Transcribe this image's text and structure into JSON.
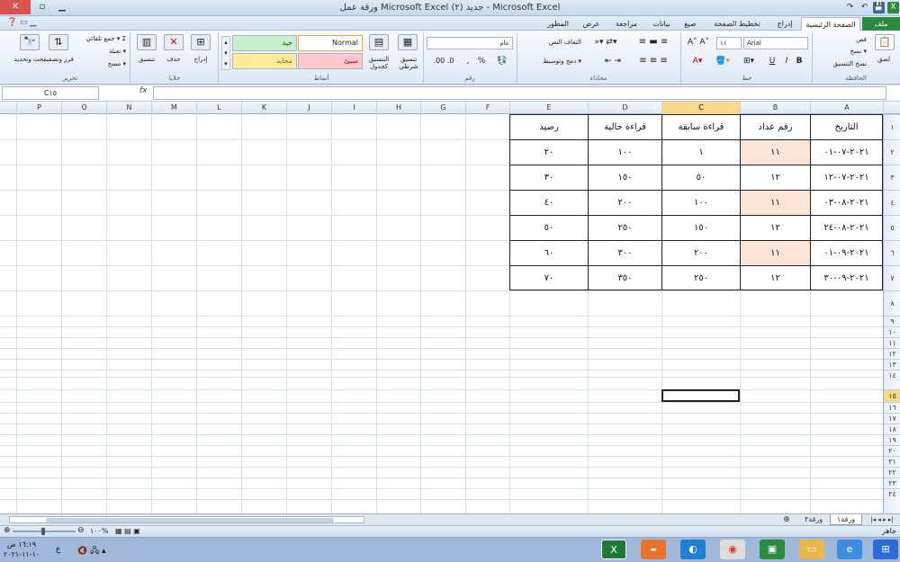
{
  "window": {
    "title": "ورقة عمل Microsoft Excel جديد (٢) - Microsoft Excel"
  },
  "qat": {
    "save": "💾",
    "undo": "↶",
    "redo": "↷"
  },
  "tabs": [
    "ملف",
    "الصفحة الرئيسية",
    "إدراج",
    "تخطيط الصفحة",
    "صيغ",
    "بيانات",
    "مراجعة",
    "عرض",
    "المطور"
  ],
  "ribbon": {
    "clipboard": {
      "label": "الحافظة",
      "paste": "لصق",
      "cut": "قص",
      "copy": "نسخ ▾",
      "format_painter": "نسخ التنسيق"
    },
    "font": {
      "label": "خط",
      "name": "Arial",
      "size": "١١",
      "bold": "B",
      "italic": "I",
      "underline": "U"
    },
    "alignment": {
      "label": "محاذاة",
      "wrap": "التفاف النص",
      "merge": "دمج وتوسيط ▾"
    },
    "number": {
      "label": "رقم",
      "format": "عام",
      "percent": "%",
      "comma": ",",
      "currency": "💱"
    },
    "styles": {
      "label": "أنماط",
      "normal": "Normal",
      "good": "جيد",
      "bad": "سيئ",
      "neutral": "محايد",
      "conditional": "تنسيق شرطي",
      "table": "التنسيق كجدول"
    },
    "cells": {
      "label": "خلايا",
      "insert": "إدراج",
      "delete": "حذف",
      "format": "تنسيق"
    },
    "editing": {
      "label": "تحرير",
      "autosum": "جمع تلقائي ▾",
      "fill": "تعبئة ▾",
      "clear": "مسح ▾",
      "sort": "فرز وتصفية",
      "find": "بحث وتحديد"
    }
  },
  "formula_bar": {
    "name_box": "C١٥",
    "fx": "fx",
    "content": ""
  },
  "columns": [
    "A",
    "B",
    "C",
    "D",
    "E",
    "F",
    "G",
    "H",
    "I",
    "J",
    "K",
    "L",
    "M",
    "N",
    "O",
    "P"
  ],
  "rows": [
    "١",
    "٢",
    "٣",
    "٤",
    "٥",
    "٦",
    "٧",
    "٨",
    "٩",
    "١٠",
    "١١",
    "١٢",
    "١٣",
    "١٤",
    "١٥",
    "١٦",
    "١٧",
    "١٨",
    "١٩",
    "٢٠",
    "٢١",
    "٢٢",
    "٢٣",
    "٢٤"
  ],
  "table": {
    "headers": [
      "التاريخ",
      "رقم عداد",
      "قراءة سابقة",
      "قراءة حالية",
      "رصيد"
    ],
    "rows": [
      [
        "٢٠٢١-٠٧-٠١",
        "١١",
        "١",
        "١٠٠",
        "٢٠"
      ],
      [
        "٢٠٢١-٠٧-١٢",
        "١٢",
        "٥٠",
        "١٥٠",
        "٣٠"
      ],
      [
        "٢٠٢١-٠٨-٠٣",
        "١١",
        "١٠٠",
        "٢٠٠",
        "٤٠"
      ],
      [
        "٢٠٢١-٠٨-٢٤",
        "١٢",
        "١٥٠",
        "٢٥٠",
        "٥٠"
      ],
      [
        "٢٠٢١-٠٩-٠١",
        "١١",
        "٢٠٠",
        "٣٠٠",
        "٦٠"
      ],
      [
        "٢٠٢١-٠٩-٣٠",
        "١٢",
        "٢٥٠",
        "٣٥٠",
        "٧٠"
      ]
    ]
  },
  "sheet_tabs": [
    "ورقة١",
    "ورقة٣"
  ],
  "status": {
    "ready": "جاهز",
    "zoom": "١٠٠%"
  },
  "taskbar": {
    "time": "١٦:١٩ ص",
    "date": "١٠-١١-٢٠٢١",
    "lang": "ع"
  },
  "colors": {
    "accent": "#2a8a3e",
    "peach": "#fce4d6",
    "selection": "#f8d88a"
  }
}
